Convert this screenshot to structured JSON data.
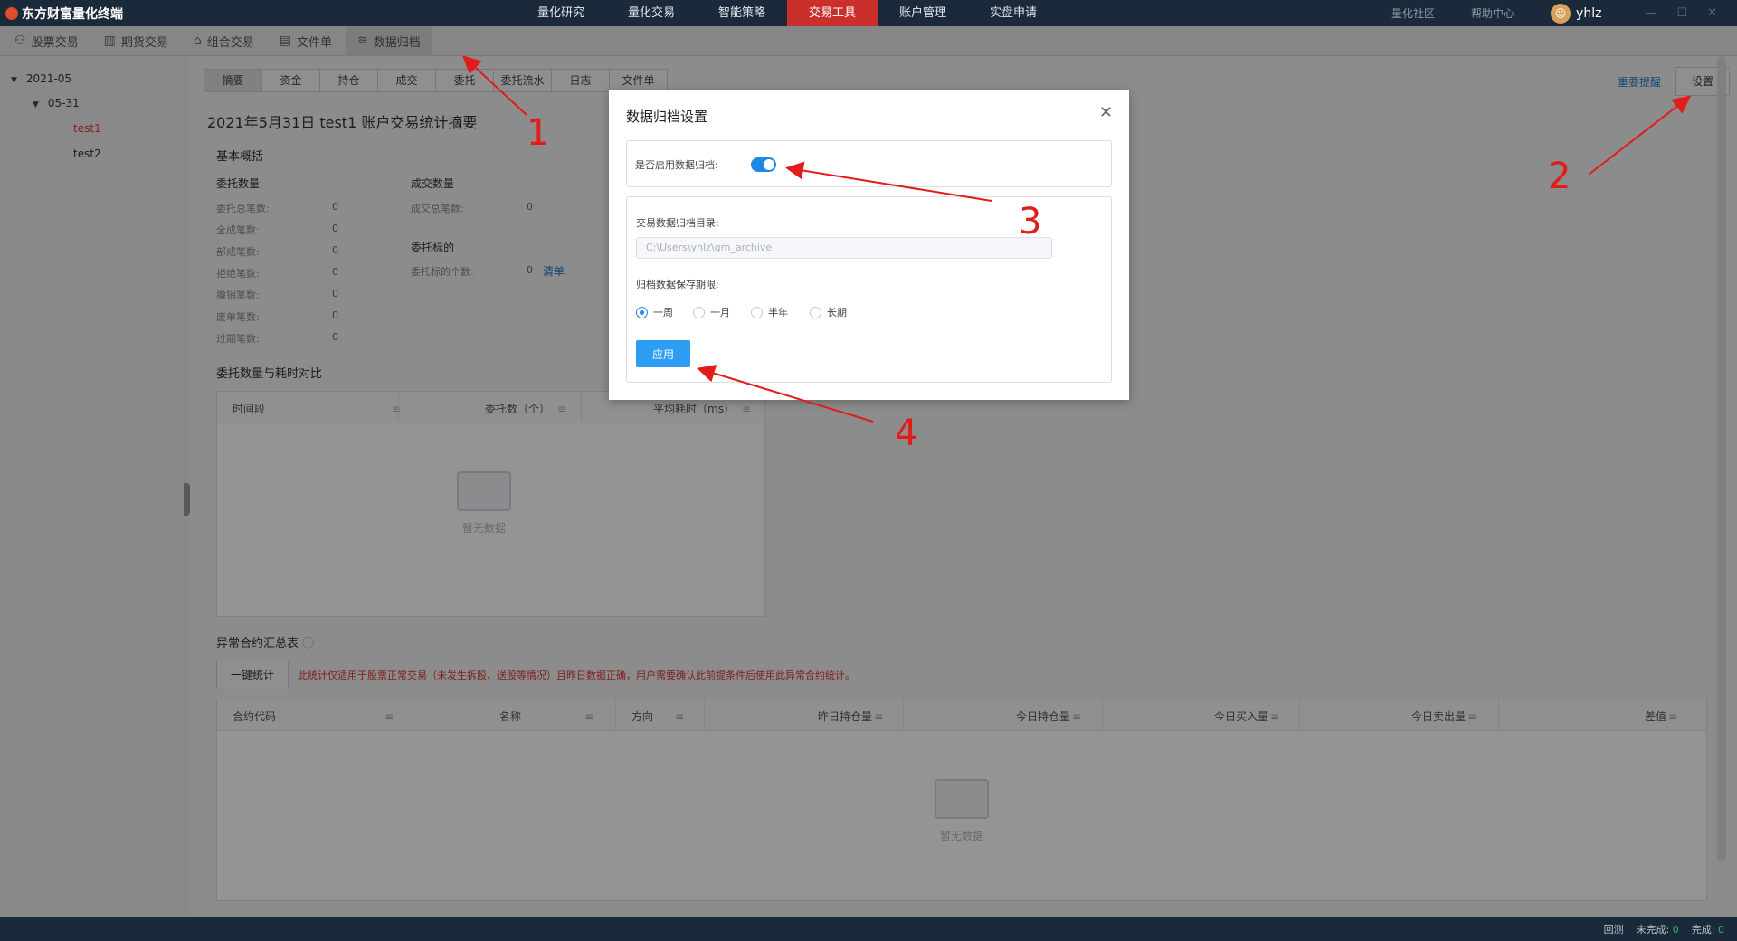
{
  "app": {
    "title": "东方财富量化终端"
  },
  "topnav": [
    {
      "label": "量化研究"
    },
    {
      "label": "量化交易"
    },
    {
      "label": "智能策略"
    },
    {
      "label": "交易工具",
      "active": true
    },
    {
      "label": "账户管理"
    },
    {
      "label": "实盘申请"
    }
  ],
  "topright": {
    "community": "量化社区",
    "help": "帮助中心",
    "user": "yhlz"
  },
  "subtabs": [
    {
      "label": "股票交易",
      "icon": "stock-icon"
    },
    {
      "label": "期货交易",
      "icon": "futures-icon"
    },
    {
      "label": "组合交易",
      "icon": "basket-icon"
    },
    {
      "label": "文件单",
      "icon": "file-icon"
    },
    {
      "label": "数据归档",
      "icon": "layers-icon",
      "active": true
    }
  ],
  "tree": {
    "month": "2021-05",
    "day": "05-31",
    "acct1": "test1",
    "acct2": "test2"
  },
  "tabs": [
    "摘要",
    "资金",
    "持仓",
    "成交",
    "委托",
    "委托流水",
    "日志",
    "文件单"
  ],
  "summary": {
    "title": "2021年5月31日 test1 账户交易统计摘要",
    "basic": "基本概括",
    "order_count": "委托数量",
    "order_rows": [
      {
        "label": "委托总笔数:",
        "value": "0"
      },
      {
        "label": "全成笔数:",
        "value": "0"
      },
      {
        "label": "部成笔数:",
        "value": "0"
      },
      {
        "label": "拒绝笔数:",
        "value": "0"
      },
      {
        "label": "撤销笔数:",
        "value": "0"
      },
      {
        "label": "废单笔数:",
        "value": "0"
      },
      {
        "label": "过期笔数:",
        "value": "0"
      }
    ],
    "fill_count": "成交数量",
    "fill_total_label": "成交总笔数:",
    "fill_total_value": "0",
    "target": "委托标的",
    "target_label": "委托标的个数:",
    "target_value": "0",
    "target_link": "清单",
    "compare_title": "委托数量与耗时对比",
    "compare_cols": [
      "时间段",
      "委托数（个）",
      "平均耗时（ms）"
    ],
    "empty": "暂无数据",
    "abnormal_title": "异常合约汇总表",
    "calc_btn": "一键统计",
    "notice": "此统计仅适用于股票正常交易（未发生拆股、送股等情况）且昨日数据正确，用户需要确认此前提条件后使用此异常合约统计。",
    "abnormal_cols": [
      "合约代码",
      "名称",
      "方向",
      "昨日持仓量",
      "今日持仓量",
      "今日买入量",
      "今日卖出量",
      "差值"
    ]
  },
  "right": {
    "remind": "重要提醒",
    "settings": "设置"
  },
  "modal": {
    "title": "数据归档设置",
    "enable_label": "是否启用数据归档:",
    "enabled": true,
    "dir_label": "交易数据归档目录:",
    "dir_value": "C:\\Users\\yhlz\\gm_archive",
    "period_label": "归档数据保存期限:",
    "options": [
      "一周",
      "一月",
      "半年",
      "长期"
    ],
    "selected": "一周",
    "apply": "应用"
  },
  "status": {
    "mode": "回测",
    "pending_label": "未完成:",
    "pending": "0",
    "done_label": "完成:",
    "done": "0"
  },
  "annotations": [
    "1",
    "2",
    "3",
    "4"
  ],
  "colors": {
    "topbar": "#1b2a3a",
    "active_nav": "#c9302c",
    "accent": "#1e88e5",
    "annotation": "#e31b1b"
  }
}
